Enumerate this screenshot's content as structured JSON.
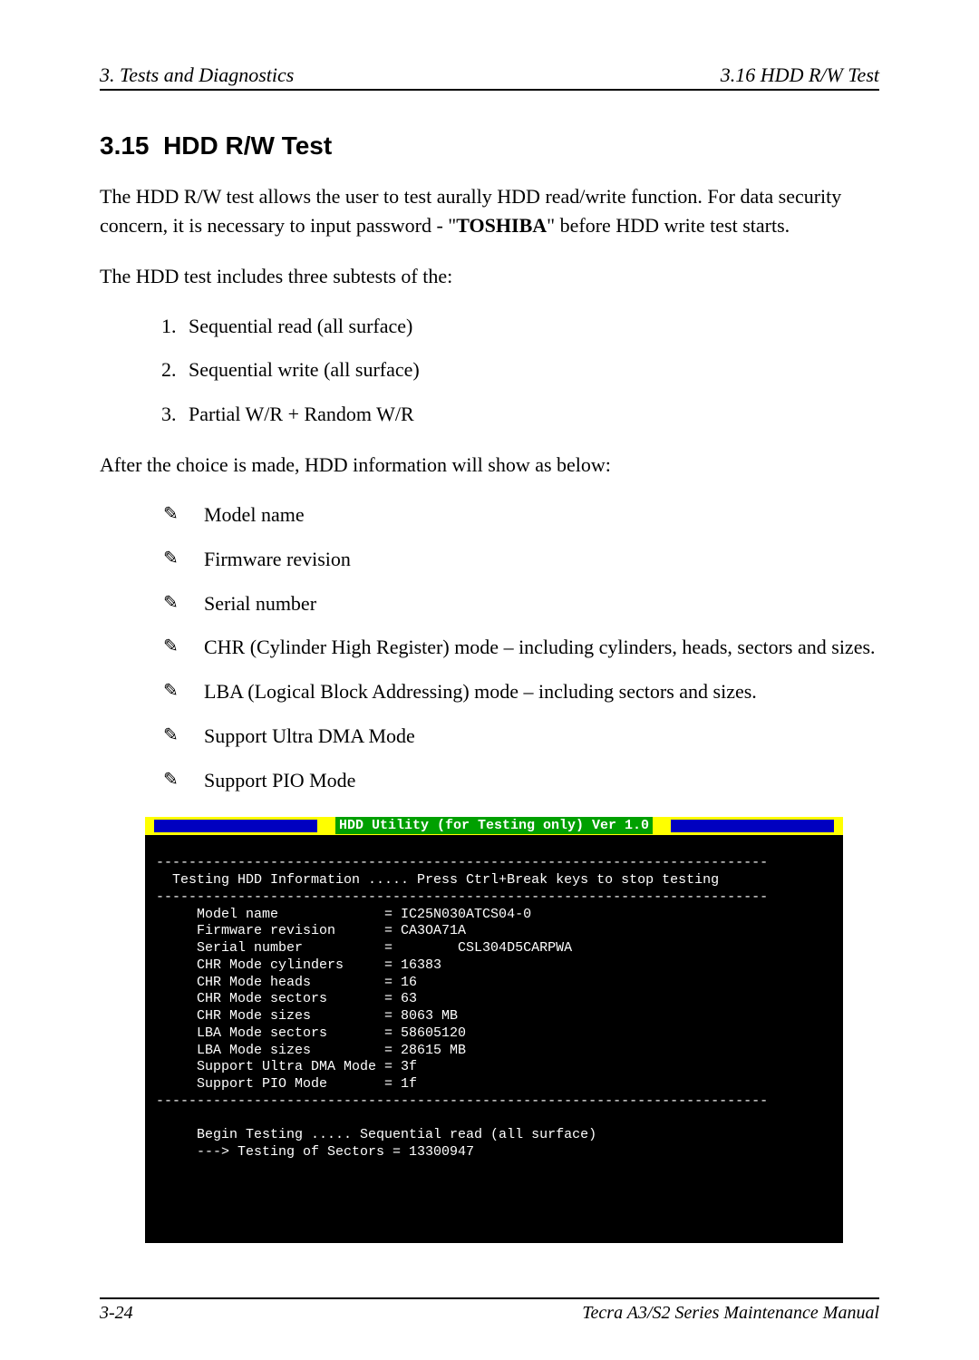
{
  "header": {
    "left": "3.  Tests and Diagnostics",
    "right": "3.16  HDD R/W Test"
  },
  "section": {
    "number": "3.15",
    "title": "HDD R/W Test"
  },
  "para1_a": "The HDD R/W test allows the user to test aurally HDD read/write function. For data security concern, it is necessary to input password - \"",
  "para1_bold": "TOSHIBA",
  "para1_b": "\" before HDD write test starts.",
  "para2": "The HDD test includes three subtests of the:",
  "numbered": [
    "Sequential read (all surface)",
    "Sequential write (all surface)",
    "Partial W/R + Random W/R"
  ],
  "para3": "After the choice is made, HDD information will show as below:",
  "bullets": [
    "Model name",
    "Firmware revision",
    "Serial number",
    "CHR (Cylinder High Register) mode – including cylinders, heads, sectors and sizes.",
    "LBA (Logical Block Addressing) mode – including sectors and sizes.",
    "Support Ultra DMA Mode",
    "Support PIO Mode"
  ],
  "console": {
    "title": "HDD Utility (for Testing only)  Ver 1.0",
    "lines": [
      "",
      "---------------------------------------------------------------------------",
      "  Testing HDD Information ..... Press Ctrl+Break keys to stop testing",
      "---------------------------------------------------------------------------",
      "     Model name             = IC25N030ATCS04-0",
      "     Firmware revision      = CA3OA71A",
      "     Serial number          =        CSL304D5CARPWA",
      "     CHR Mode cylinders     = 16383",
      "     CHR Mode heads         = 16",
      "     CHR Mode sectors       = 63",
      "     CHR Mode sizes         = 8063 MB",
      "     LBA Mode sectors       = 58605120",
      "     LBA Mode sizes         = 28615 MB",
      "     Support Ultra DMA Mode = 3f",
      "     Support PIO Mode       = 1f",
      "---------------------------------------------------------------------------",
      "",
      "     Begin Testing ..... Sequential read (all surface)",
      "     ---> Testing of Sectors = 13300947"
    ]
  },
  "footer": {
    "left": "3-24",
    "right": "Tecra A3/S2 Series Maintenance Manual"
  }
}
